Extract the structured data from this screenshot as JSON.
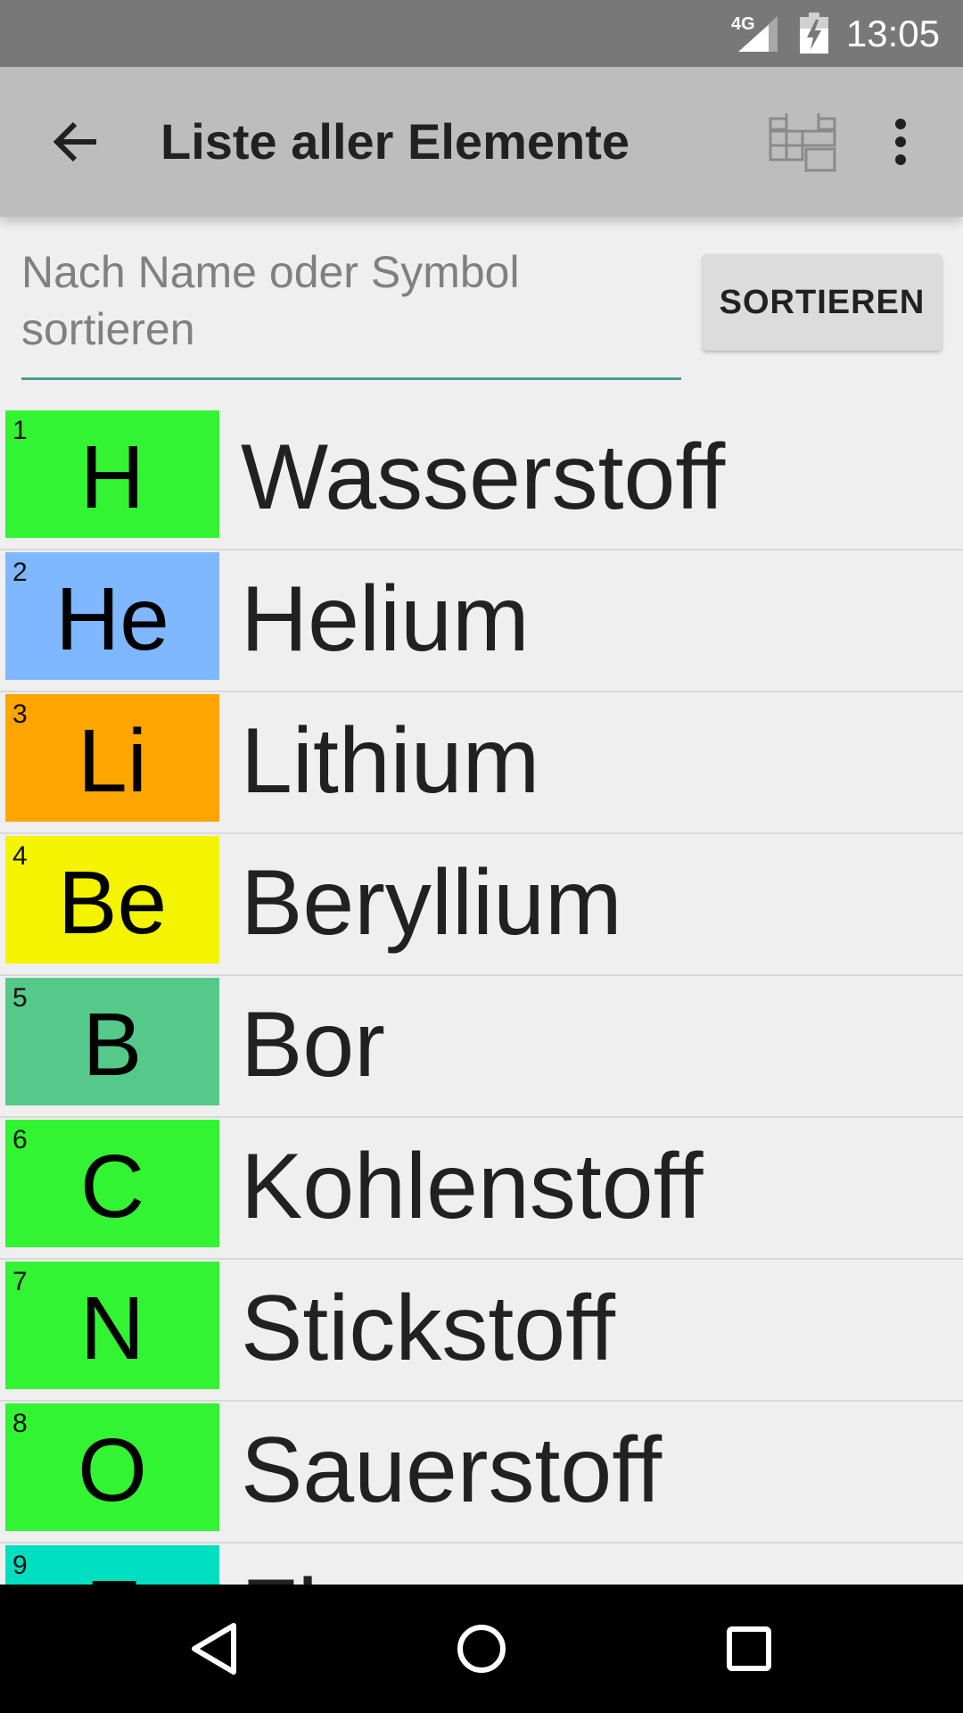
{
  "status_bar": {
    "network": "4G",
    "time": "13:05"
  },
  "toolbar": {
    "title": "Liste aller Elemente",
    "icons": {
      "back": "arrow-back-icon",
      "table_view": "periodic-table-icon",
      "overflow": "more-vert-icon"
    }
  },
  "search": {
    "placeholder": "Nach Name oder Symbol sortieren",
    "value": "",
    "sort_label": "SORTIEREN"
  },
  "elements": [
    {
      "number": "1",
      "symbol": "H",
      "name": "Wasserstoff",
      "color": "#33f433"
    },
    {
      "number": "2",
      "symbol": "He",
      "name": "Helium",
      "color": "#7fb7ff"
    },
    {
      "number": "3",
      "symbol": "Li",
      "name": "Lithium",
      "color": "#ffa500"
    },
    {
      "number": "4",
      "symbol": "Be",
      "name": "Beryllium",
      "color": "#f4f400"
    },
    {
      "number": "5",
      "symbol": "B",
      "name": "Bor",
      "color": "#55c98a"
    },
    {
      "number": "6",
      "symbol": "C",
      "name": "Kohlenstoff",
      "color": "#33f433"
    },
    {
      "number": "7",
      "symbol": "N",
      "name": "Stickstoff",
      "color": "#33f433"
    },
    {
      "number": "8",
      "symbol": "O",
      "name": "Sauerstoff",
      "color": "#33f433"
    },
    {
      "number": "9",
      "symbol": "F",
      "name": "Fluor",
      "color": "#00e0c0"
    }
  ],
  "nav_bar": {
    "back": "nav-back-icon",
    "home": "nav-home-icon",
    "recents": "nav-recents-icon"
  }
}
